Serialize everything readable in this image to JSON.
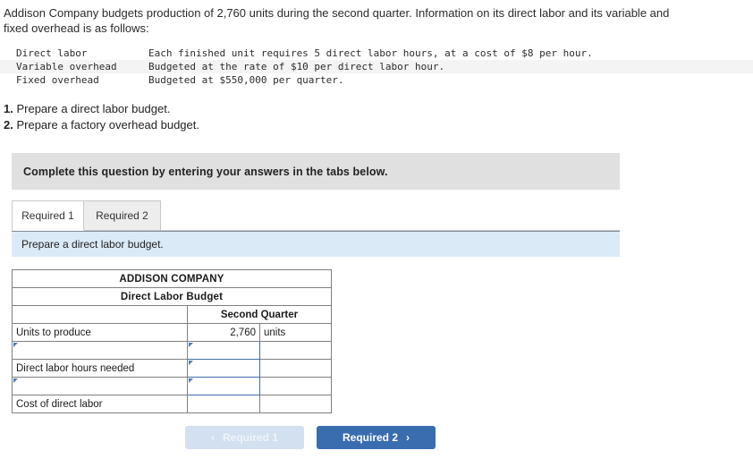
{
  "problem": {
    "stem": "Addison Company budgets production of 2,760 units during the second quarter. Information on its direct labor and its variable and fixed overhead is as follows:",
    "given": [
      {
        "label": "Direct labor",
        "description": "Each finished unit requires 5 direct labor hours, at a cost of $8 per hour."
      },
      {
        "label": "Variable overhead",
        "description": "Budgeted at the rate of $10 per direct labor hour."
      },
      {
        "label": "Fixed overhead",
        "description": "Budgeted at $550,000 per quarter."
      }
    ],
    "requirements": [
      {
        "num": "1.",
        "text": "Prepare a direct labor budget."
      },
      {
        "num": "2.",
        "text": "Prepare a factory overhead budget."
      }
    ]
  },
  "instruction_banner": {
    "text": "Complete this question by entering your answers in the tabs below."
  },
  "tabs": [
    {
      "label": "Required 1",
      "active": true
    },
    {
      "label": "Required 2",
      "active": false
    }
  ],
  "prompt_bar": {
    "text": "Prepare a direct labor budget."
  },
  "worksheet": {
    "company": "ADDISON COMPANY",
    "budget_title": "Direct Labor Budget",
    "column_header": "Second Quarter",
    "rows": [
      {
        "label": "Units to produce",
        "value": "2,760",
        "units": "units",
        "label_editable": false,
        "value_editable": false,
        "answer": false
      },
      {
        "label": "",
        "value": "",
        "units": "",
        "label_editable": true,
        "value_editable": true,
        "answer": false
      },
      {
        "label": "Direct labor hours needed",
        "value": "",
        "units": "",
        "label_editable": false,
        "value_editable": true,
        "answer": false
      },
      {
        "label": "",
        "value": "",
        "units": "",
        "label_editable": true,
        "value_editable": true,
        "answer": false
      },
      {
        "label": "Cost of direct labor",
        "value": "",
        "units": "",
        "label_editable": false,
        "value_editable": false,
        "answer": true
      }
    ]
  },
  "nav": {
    "prev_label": "Required 1",
    "prev_chevron": "‹",
    "next_label": "Required 2",
    "next_chevron": "›"
  },
  "colors": {
    "table_header_blue": "#7aaee0",
    "prompt_bar_blue": "#dbeaf7",
    "banner_gray": "#e0e0e0",
    "next_button_blue": "#3a6cb0",
    "prev_button_blue": "#d3e0ef",
    "answer_yellow": "#fcf8c3",
    "editable_border": "#6a92c0"
  }
}
